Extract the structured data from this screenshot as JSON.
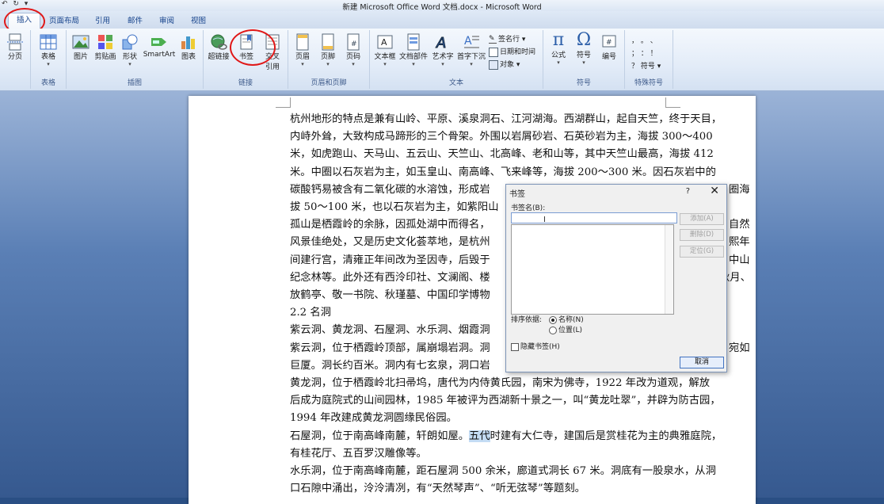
{
  "titlebar": {
    "qat": "↶ ↻ ▾",
    "title": "新建 Microsoft Office Word 文档.docx - Microsoft Word"
  },
  "tabs": [
    {
      "label": "插入"
    },
    {
      "label": "页面布局"
    },
    {
      "label": "引用"
    },
    {
      "label": "邮件"
    },
    {
      "label": "审阅"
    },
    {
      "label": "视图"
    }
  ],
  "ribbon": {
    "groups": [
      {
        "label": "表格"
      },
      {
        "label": "插图"
      },
      {
        "label": "链接"
      },
      {
        "label": "页眉和页脚"
      },
      {
        "label": "文本"
      },
      {
        "label": "符号"
      },
      {
        "label": "特殊符号"
      }
    ],
    "buttons": {
      "fenye": "分页",
      "biaoge": "表格",
      "tupian": "图片",
      "jianbao": "剪贴画",
      "xingzhuang": "形状",
      "smartart": "SmartArt",
      "tubiao": "图表",
      "chaolianjie": "超链接",
      "shuqian": "书签",
      "jiaocha1": "交叉",
      "jiaocha2": "引用",
      "yemei": "页眉",
      "yejiao": "页脚",
      "yema": "页码",
      "wenbenkuang": "文本框",
      "wendangbujian": "文档部件",
      "yishuzi": "艺术字",
      "shouzixiachen": "首字下沉",
      "qianmingxing": "签名行 ▾",
      "riqi": "日期和时间",
      "duixiang": "对象 ▾",
      "gongshi": "公式",
      "fuhao": "符号",
      "bianhao": "编号",
      "teshu_row1": "，  。  、",
      "teshu_row2": "；  ：  ！",
      "teshu_row3": "？ 符号 ▾"
    }
  },
  "doc": {
    "lines": [
      "杭州地形的特点是兼有山岭、平原、溪泉洞石、江河湖海。西湖群山，起自天竺，终于天目，",
      "内峙外耸，大致构成马蹄形的三个骨架。外围以岩屑砂岩、石英砂岩为主，海拔  300～400",
      "米，如虎跑山、天马山、五云山、天竺山、北高峰、老和山等，其中天竺山最高，海拔 412",
      "米。中圈以石灰岩为主，如玉皇山、南高峰、飞来峰等，海拔 200～300 米。因石灰岩中的",
      "碳酸钙易被含有二氧化碳的水溶蚀，形成岩",
      "拔 50～100 米，也以石灰岩为主，如紫阳山",
      "孤山是栖霞岭的余脉，因孤处湖中而得名，",
      "风景佳绝处，又是历史文化荟萃地，是杭州",
      "间建行宫，清雍正年间改为圣因寺，后毁于",
      "纪念林等。此外还有西泠印社、文澜阁、楼",
      "放鹤亭、敬一书院、秋瑾墓、中国印学博物",
      "2.2  名洞",
      "紫云洞、黄龙洞、石屋洞、水乐洞、烟霞洞",
      "紫云洞，位于栖霞岭顶部，属崩塌岩洞。洞",
      "巨厦。洞长约百米。洞内有七玄泉，洞口岩"
    ],
    "right_fragments": [
      "圈海",
      "自然",
      "熙年",
      "中山",
      "秋月、",
      "宛如"
    ],
    "full_lines": [
      "黄龙洞，位于栖霞岭北扫帚坞，唐代为内侍黄氏园，南宋为佛寺，1922  年改为道观，解放",
      "后成为庭院式的山间园林，1985 年被评为西湖新十景之一，叫“黄龙吐翠”，并辟为防古园，",
      "1994 年改建成黄龙洞圆缘民俗园。"
    ],
    "shiwu_pre": "石屋洞，位于南高峰南麓，轩朗如屋。",
    "shiwu_hl": "五代",
    "shiwu_post": "时建有大仁寺，建国后是赏桂花为主的典雅庭院，",
    "tail_lines": [
      "有桂花厅、五百罗汉雕像等。",
      "水乐洞，位于南高峰南麓，距石屋洞 500 余米，廊道式洞长 67 米。洞底有一股泉水，从洞",
      "口石隙中涌出，泠泠清冽，有“天然琴声”、“听无弦琴”等题刻。"
    ]
  },
  "dialog": {
    "title": "书签",
    "help": "?",
    "close": "✕",
    "name_label": "书签名(B):",
    "input_value": "",
    "add": "添加(A)",
    "delete": "删除(D)",
    "goto": "定位(G)",
    "sort_label": "排序依据:",
    "sort_name": "名称(N)",
    "sort_pos": "位置(L)",
    "hidden": "隐藏书签(H)",
    "cancel": "取消"
  }
}
